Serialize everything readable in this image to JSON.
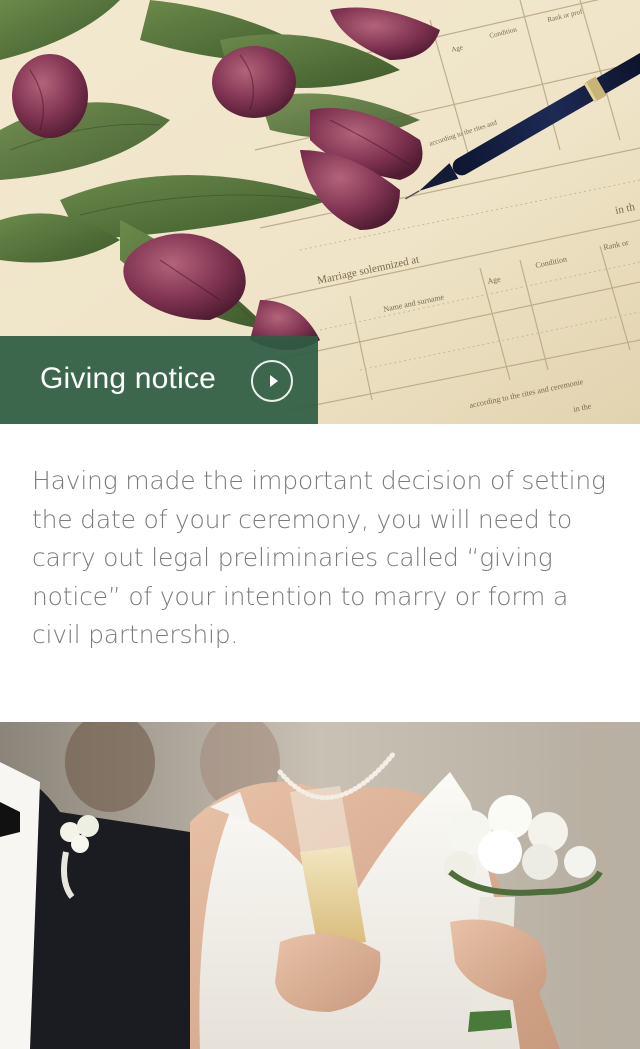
{
  "hero": {
    "image": "marriage-certificate-with-tulips-and-pen",
    "banner_title": "Giving notice",
    "banner_color": "#2e5c42",
    "action_icon": "play-circle-icon"
  },
  "intro": {
    "text": "Having made the important decision of setting the date of your ceremony, you will need to carry out legal preliminaries called “giving notice” of your intention to marry or form a civil partnership."
  },
  "bottom_photo": {
    "image": "bride-with-champagne-and-bouquet"
  }
}
